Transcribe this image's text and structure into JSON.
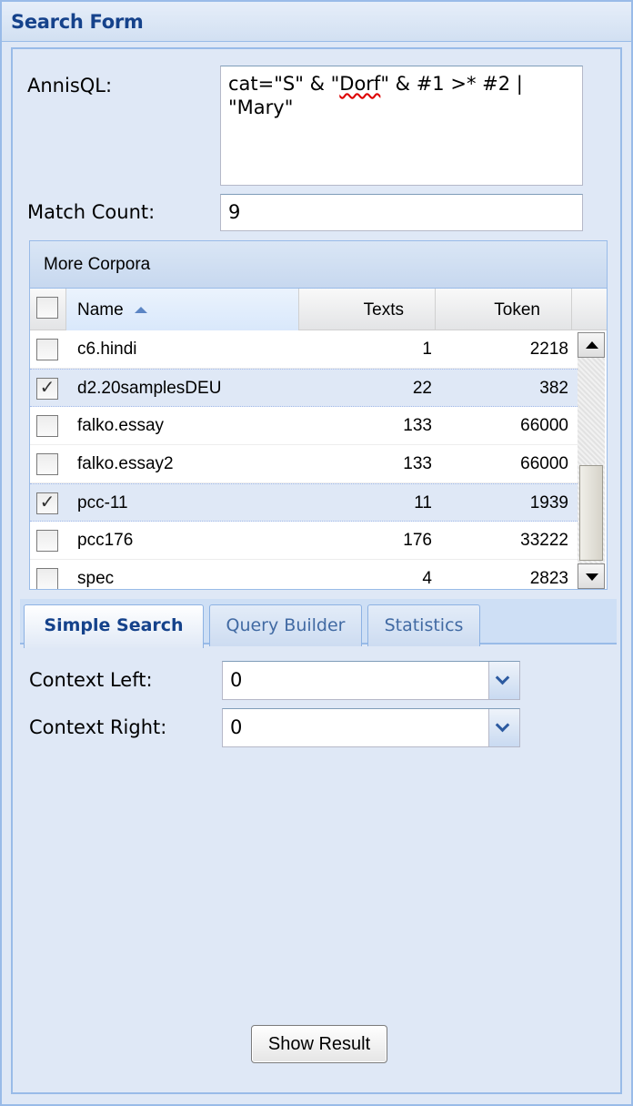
{
  "panel": {
    "title": "Search Form"
  },
  "form": {
    "annisql_label": "AnnisQL:",
    "query_parts": [
      "cat=\"S\" & \"",
      "Dorf",
      "\" & #1 >* #2 |\n\"Mary\""
    ],
    "match_count_label": "Match Count:",
    "match_count_value": "9"
  },
  "grid": {
    "title": "More Corpora",
    "columns": [
      "Name",
      "Texts",
      "Token"
    ],
    "rows": [
      {
        "name": "c6.hindi",
        "texts": "1",
        "token": "2218",
        "checked": false
      },
      {
        "name": "d2.20samplesDEU",
        "texts": "22",
        "token": "382",
        "checked": true
      },
      {
        "name": "falko.essay",
        "texts": "133",
        "token": "66000",
        "checked": false
      },
      {
        "name": "falko.essay2",
        "texts": "133",
        "token": "66000",
        "checked": false
      },
      {
        "name": "pcc-11",
        "texts": "11",
        "token": "1939",
        "checked": true
      },
      {
        "name": "pcc176",
        "texts": "176",
        "token": "33222",
        "checked": false
      },
      {
        "name": "spec",
        "texts": "4",
        "token": "2823",
        "checked": false
      }
    ]
  },
  "tabs": [
    "Simple Search",
    "Query Builder",
    "Statistics"
  ],
  "simple_search": {
    "context_left_label": "Context Left:",
    "context_left_value": "0",
    "context_right_label": "Context Right:",
    "context_right_value": "0"
  },
  "show_result_label": "Show Result",
  "colors": {
    "title": "#15428b",
    "border": "#99bbe8",
    "selected_row": "#dfe8f6"
  }
}
